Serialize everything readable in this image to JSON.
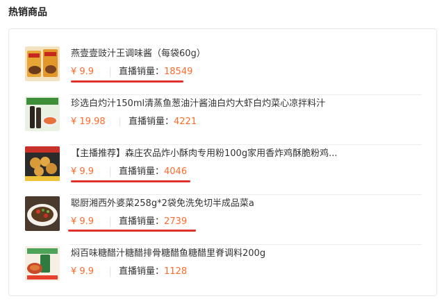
{
  "section": {
    "title": "热销商品"
  },
  "products": [
    {
      "name": "燕壹壹豉汁王调味酱（每袋60g）",
      "price": "¥ 9.9",
      "sales_label": "直播销量：",
      "sales_value": "18549",
      "thumb_icon": "sauce-packet-image"
    },
    {
      "name": "珍选白灼汁150ml清蒸鱼葱油汁酱油白灼大虾白灼菜心凉拌料汁",
      "price": "¥ 19.98",
      "sales_label": "直播销量：",
      "sales_value": "4221",
      "thumb_icon": "sauce-bottle-image"
    },
    {
      "name": "【主播推荐】森庄农品炸小酥肉专用粉100g家用香炸鸡酥脆粉鸡...",
      "price": "¥ 9.9",
      "sales_label": "直播销量：",
      "sales_value": "4046",
      "thumb_icon": "fried-chicken-image"
    },
    {
      "name": "聪厨湘西外婆菜258g*2袋免洗免切半成品菜a",
      "price": "¥ 9.9",
      "sales_label": "直播销量：",
      "sales_value": "2739",
      "thumb_icon": "vegetable-dish-image"
    },
    {
      "name": "焖百味糖醋汁糖醋排骨糖醋鱼糖醋里脊调料200g",
      "price": "¥ 9.9",
      "sales_label": "直播销量：",
      "sales_value": "1128",
      "thumb_icon": "sweet-sour-sauce-image"
    }
  ],
  "colors": {
    "accent": "#ff6a2c",
    "highlight": "#e0302a"
  }
}
